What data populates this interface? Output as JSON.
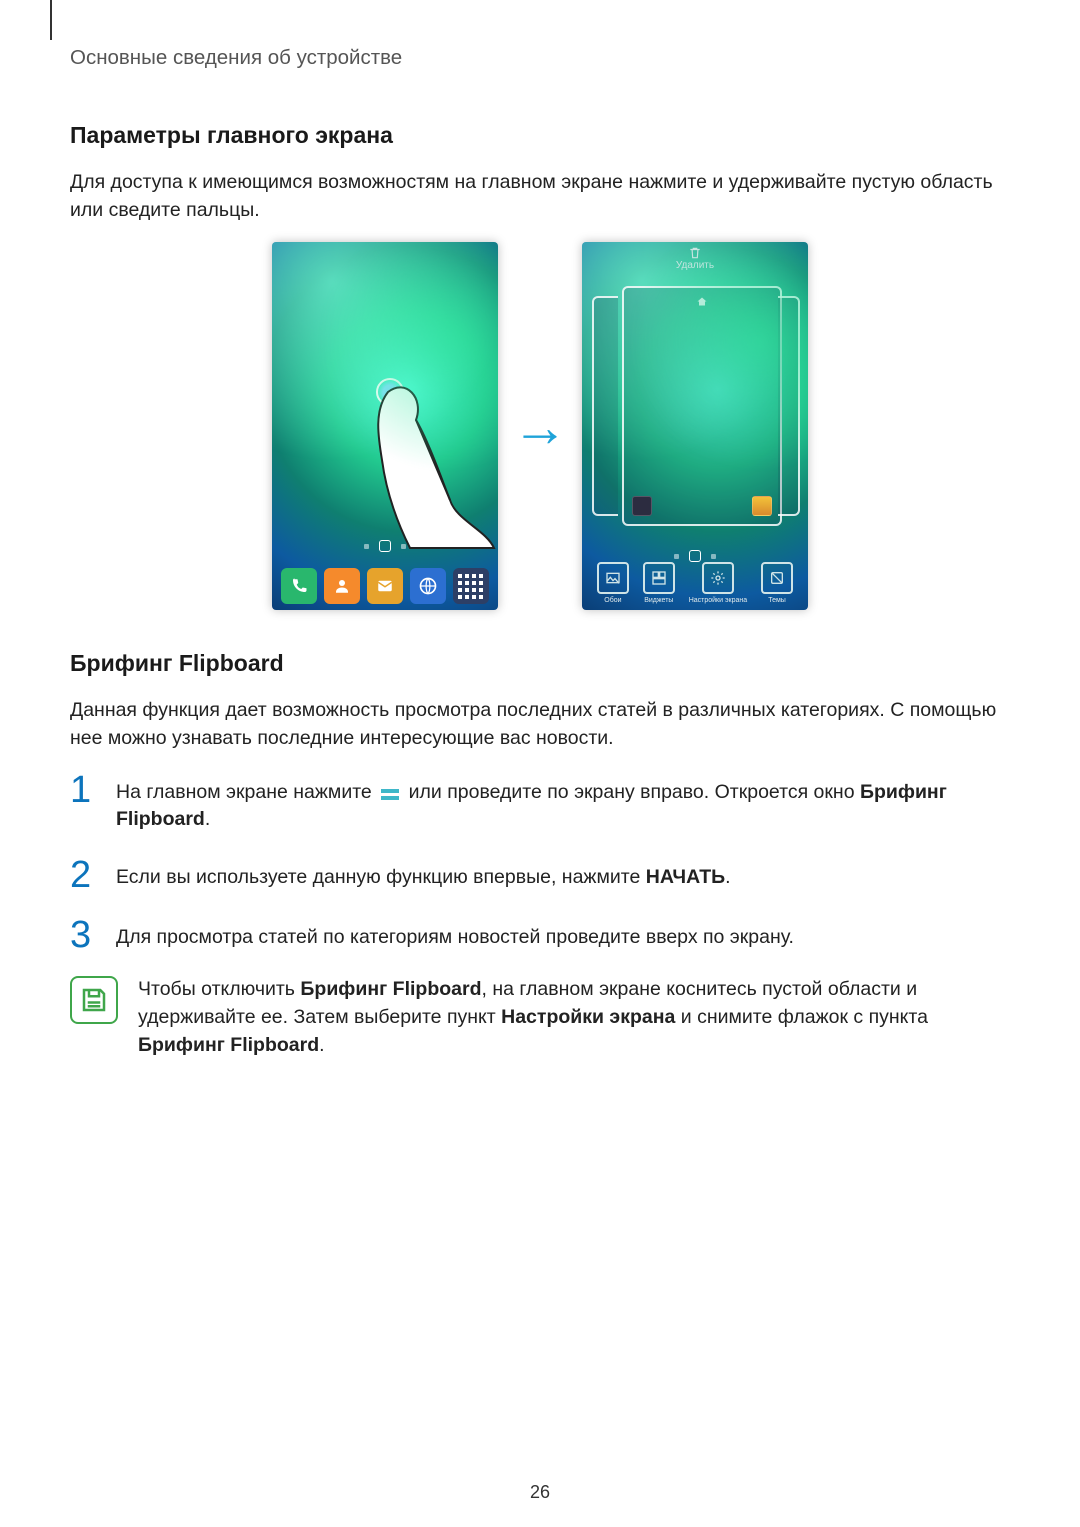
{
  "breadcrumb": "Основные сведения об устройстве",
  "section1": {
    "heading": "Параметры главного экрана",
    "body": "Для доступа к имеющимся возможностям на главном экране нажмите и удерживайте пустую область или сведите пальцы."
  },
  "left_phone": {
    "dock_icons": [
      "phone-icon",
      "contacts-icon",
      "messages-icon",
      "internet-icon",
      "apps-icon"
    ]
  },
  "right_phone": {
    "top_label": "Удалить",
    "bottom_labels": [
      "Обои",
      "Виджеты",
      "Настройки экрана",
      "Темы"
    ]
  },
  "section2": {
    "heading": "Брифинг Flipboard",
    "body": "Данная функция дает возможность просмотра последних статей в различных категориях. С помощью нее можно узнавать последние интересующие вас новости."
  },
  "steps": {
    "s1_pre": "На главном экране нажмите ",
    "s1_post": " или проведите по экрану вправо. Откроется окно ",
    "s1_bold": "Брифинг Flipboard",
    "s1_end": ".",
    "s2_pre": "Если вы используете данную функцию впервые, нажмите ",
    "s2_bold": "НАЧАТЬ",
    "s2_end": ".",
    "s3": "Для просмотра статей по категориям новостей проведите вверх по экрану."
  },
  "note": {
    "pre": "Чтобы отключить ",
    "b1": "Брифинг Flipboard",
    "mid1": ", на главном экране коснитесь пустой области и удерживайте ее. Затем выберите пункт ",
    "b2": "Настройки экрана",
    "mid2": " и снимите флажок с пункта ",
    "b3": "Брифинг Flipboard",
    "end": "."
  },
  "pagenum": "26"
}
